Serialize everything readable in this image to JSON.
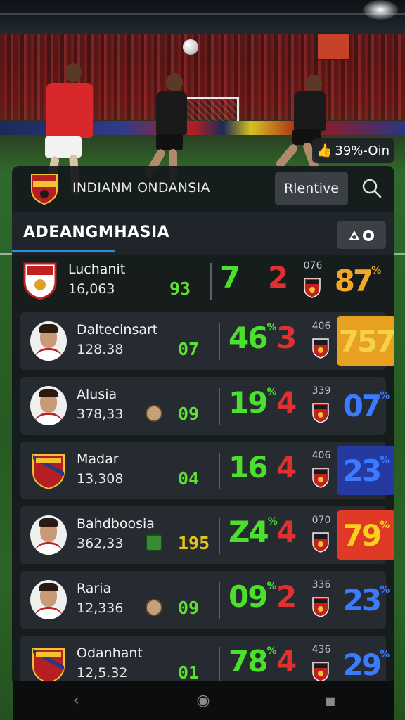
{
  "topbar": {
    "title": "INDIANM ONDANSIA",
    "filter_label": "Rlentive"
  },
  "top_badge": {
    "text": "39%-Oin",
    "icon": "thumbs-up-icon"
  },
  "section": {
    "title": "ADEANGMHASIA"
  },
  "colors": {
    "green": "#4ae02c",
    "red": "#e03030",
    "orange": "#e8a020",
    "blue": "#2f5ad8",
    "accent": "#2f8fd6"
  },
  "rows": [
    {
      "name": "Luchanit",
      "value": "16,063",
      "score": "93",
      "big_left": "7",
      "big_left_sup": "",
      "big_right": "2",
      "small": "076",
      "rating": "87",
      "rating_sup": "%",
      "rating_style": "plain-orange",
      "avatar": "crest-red"
    },
    {
      "name": "Daltecinsart",
      "value": "128.38",
      "score": "07",
      "big_left": "46",
      "big_left_sup": "%",
      "big_right": "3",
      "small": "406",
      "rating": "757",
      "rating_sup": "",
      "rating_style": "orange",
      "avatar": "face"
    },
    {
      "name": "Alusia",
      "value": "378,33",
      "score": "09",
      "big_left": "19",
      "big_left_sup": "%",
      "big_right": "4",
      "small": "339",
      "rating": "07",
      "rating_sup": "%",
      "rating_style": "plain-blue",
      "avatar": "face",
      "mini": "orange"
    },
    {
      "name": "Madar",
      "value": "13,308",
      "score": "04",
      "big_left": "16",
      "big_left_sup": "",
      "big_right": "4",
      "small": "406",
      "rating": "23",
      "rating_sup": "%",
      "rating_style": "blue",
      "avatar": "crest-shield"
    },
    {
      "name": "Bahdboosia",
      "value": "362,33",
      "score": "195",
      "big_left": "Z4",
      "big_left_sup": "%",
      "big_right": "4",
      "small": "070",
      "rating": "79",
      "rating_sup": "%",
      "rating_style": "red",
      "avatar": "face",
      "mini": "green"
    },
    {
      "name": "Raria",
      "value": "12,336",
      "score": "09",
      "big_left": "09",
      "big_left_sup": "%",
      "big_right": "2",
      "small": "336",
      "rating": "23",
      "rating_sup": "%",
      "rating_style": "plain-blue",
      "avatar": "face",
      "mini": "orange"
    },
    {
      "name": "Odanhant",
      "value": "12,5.32",
      "score": "01",
      "big_left": "78",
      "big_left_sup": "%",
      "big_right": "4",
      "small": "436",
      "rating": "29",
      "rating_sup": "%",
      "rating_style": "plain-blue",
      "avatar": "crest-shield"
    }
  ],
  "bottom_nav": {
    "back": "‹",
    "home": "◉",
    "recents": "■"
  }
}
